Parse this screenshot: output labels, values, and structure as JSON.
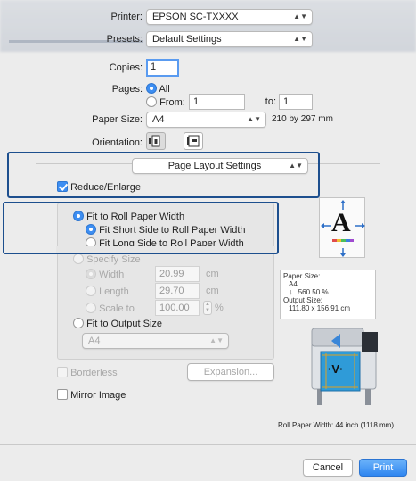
{
  "printer": {
    "label": "Printer:",
    "value": "EPSON SC-TXXXX"
  },
  "presets": {
    "label": "Presets:",
    "value": "Default Settings"
  },
  "copies": {
    "label": "Copies:",
    "value": "1"
  },
  "pages": {
    "label": "Pages:",
    "all": "All",
    "from_label": "From:",
    "from_value": "1",
    "to_label": "to:",
    "to_value": "1"
  },
  "paper_size": {
    "label": "Paper Size:",
    "value": "A4",
    "dims": "210 by 297 mm"
  },
  "orientation": {
    "label": "Orientation:"
  },
  "panel": {
    "value": "Page Layout Settings"
  },
  "reduce_enlarge": {
    "label": "Reduce/Enlarge"
  },
  "fit_roll": {
    "label": "Fit to Roll Paper Width",
    "short": "Fit Short Side to Roll Paper Width",
    "long": "Fit Long Side to Roll Paper Width"
  },
  "specify_size": {
    "label": "Specify Size",
    "width_label": "Width",
    "width_value": "20.99",
    "width_unit": "cm",
    "length_label": "Length",
    "length_value": "29.70",
    "length_unit": "cm",
    "scale_label": "Scale to",
    "scale_value": "100.00",
    "scale_unit": "%"
  },
  "fit_output": {
    "label": "Fit to Output Size",
    "value": "A4"
  },
  "preview_info": {
    "paper_size_label": "Paper Size:",
    "paper_size_value": "A4",
    "scale_value": "560.50",
    "scale_unit": "%",
    "output_size_label": "Output Size:",
    "output_size_value": "111.80 x 156.91 cm"
  },
  "preview_letter": "A",
  "printer_letter": "V",
  "borderless": {
    "label": "Borderless"
  },
  "expansion": {
    "label": "Expansion..."
  },
  "mirror_image": {
    "label": "Mirror Image"
  },
  "roll_width": "Roll Paper Width:  44 inch (1118 mm)",
  "buttons": {
    "cancel": "Cancel",
    "print": "Print"
  },
  "colors": {
    "accent": "#3d8ef2",
    "highlight": "#1d4f8e"
  }
}
